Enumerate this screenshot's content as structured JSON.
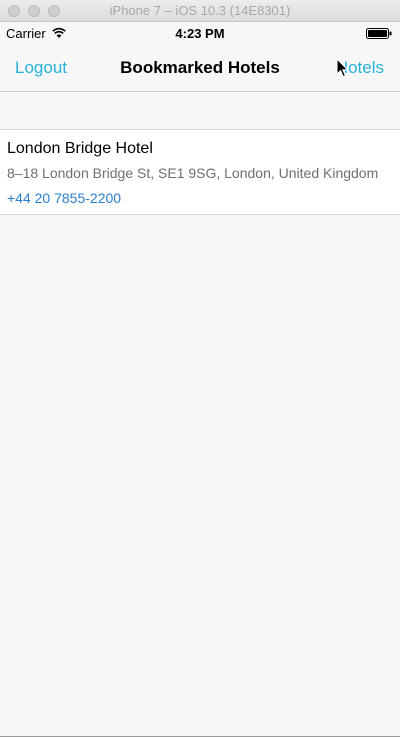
{
  "simulator": {
    "title": "iPhone 7 – iOS 10.3 (14E8301)"
  },
  "statusbar": {
    "carrier": "Carrier",
    "time": "4:23 PM"
  },
  "navbar": {
    "left_label": "Logout",
    "title": "Bookmarked Hotels",
    "right_label": "Hotels"
  },
  "hotels": [
    {
      "name": "London Bridge Hotel",
      "address": "8–18 London Bridge St, SE1 9SG, London, United Kingdom",
      "phone": "+44 20 7855-2200"
    }
  ],
  "colors": {
    "tint": "#27b2d9",
    "phone_link": "#2a7fd0",
    "background": "#f7f7f9"
  }
}
